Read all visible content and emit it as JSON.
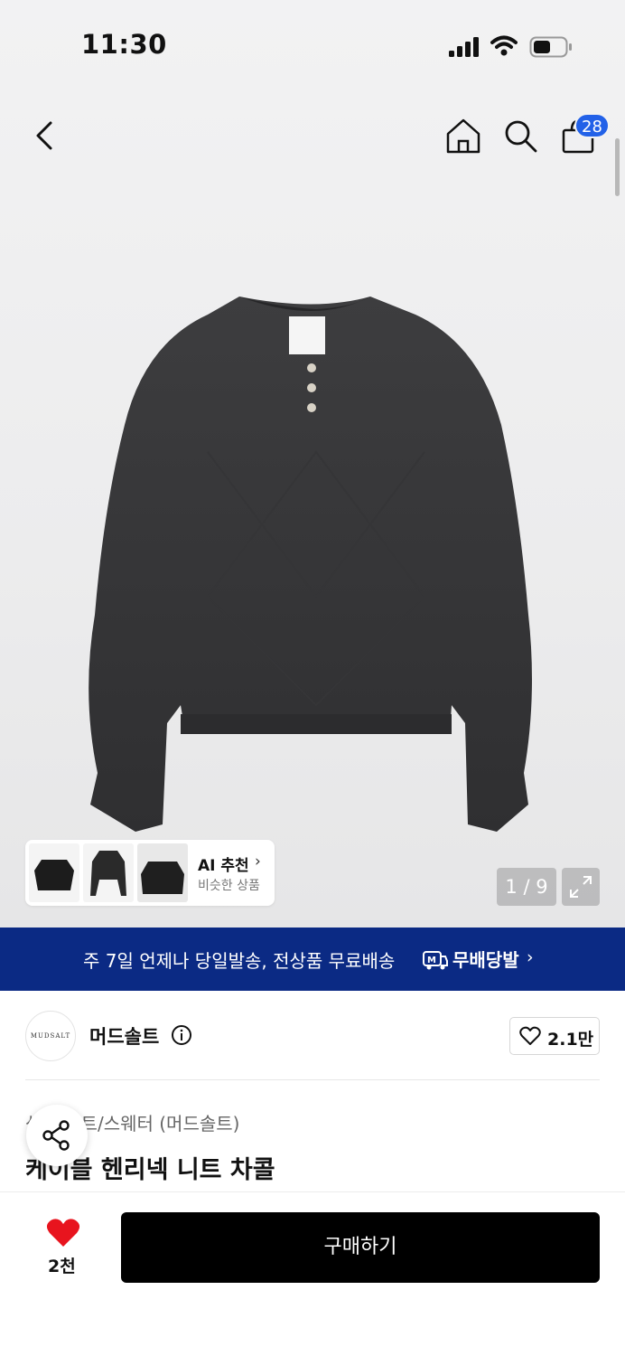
{
  "status_bar": {
    "time": "11:30"
  },
  "header": {
    "back_icon": "chevron-left-icon",
    "home_icon": "home-icon",
    "search_icon": "search-icon",
    "cart_icon": "shopping-bag-icon",
    "cart_count": "28",
    "badge_color": "#2261e8"
  },
  "gallery": {
    "page_indicator": "1 / 9",
    "ai_recommend": {
      "title": "AI 추천",
      "subtitle": "비슷한 상품"
    }
  },
  "banner": {
    "text": "주 7일 언제나 당일발송, 전상품 무료배송",
    "brand": "무배당발",
    "color": "#0b2a84"
  },
  "brand": {
    "logo_text": "MUDSALT",
    "name": "머드솔트",
    "like_count": "2.1만"
  },
  "product": {
    "category": "상의  니트/스웨터 (머드솔트)",
    "title": "케이블 헨리넥 니트 차콜"
  },
  "bottom_bar": {
    "wish_count": "2천",
    "buy_label": "구매하기",
    "heart_color": "#e8141e"
  }
}
